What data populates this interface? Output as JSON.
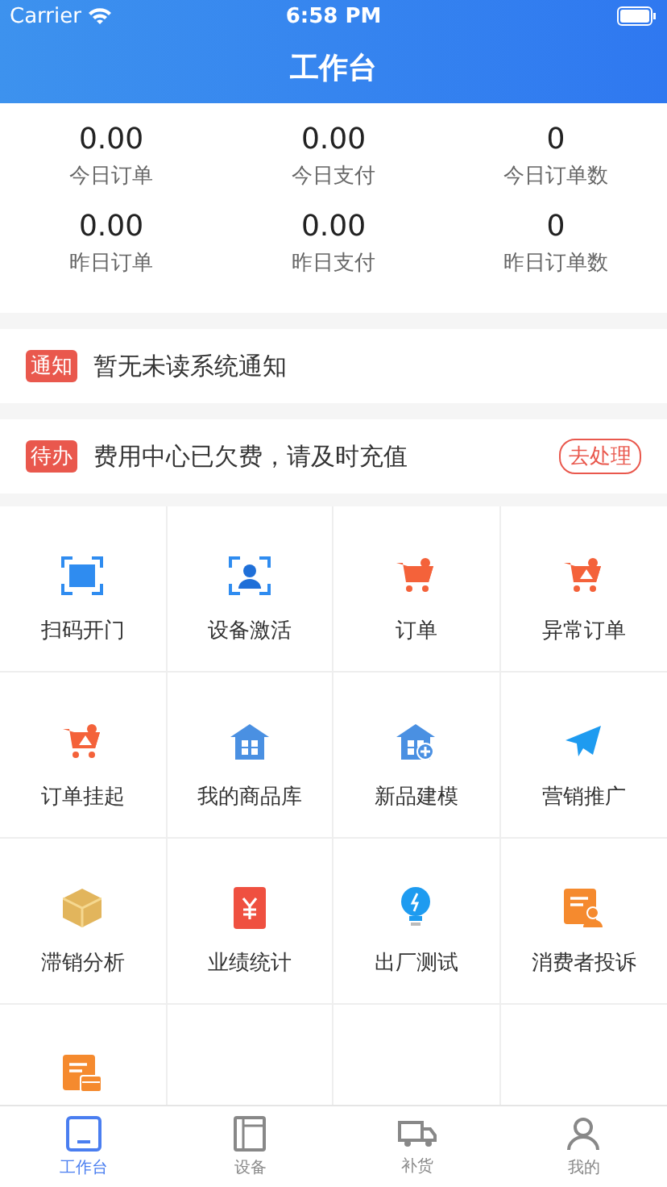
{
  "status_bar": {
    "carrier": "Carrier",
    "time": "6:58 PM"
  },
  "nav": {
    "title": "工作台"
  },
  "stats": [
    {
      "value": "0.00",
      "label": "今日订单"
    },
    {
      "value": "0.00",
      "label": "今日支付"
    },
    {
      "value": "0",
      "label": "今日订单数"
    },
    {
      "value": "0.00",
      "label": "昨日订单"
    },
    {
      "value": "0.00",
      "label": "昨日支付"
    },
    {
      "value": "0",
      "label": "昨日订单数"
    }
  ],
  "notices": [
    {
      "tag": "通知",
      "text": "暂无未读系统通知"
    },
    {
      "tag": "待办",
      "text": "费用中心已欠费，请及时充值",
      "action": "去处理"
    }
  ],
  "grid": [
    {
      "kind": "scan",
      "label": "扫码开门"
    },
    {
      "kind": "activate",
      "label": "设备激活"
    },
    {
      "kind": "cart",
      "label": "订单"
    },
    {
      "kind": "cart-alert",
      "label": "异常订单"
    },
    {
      "kind": "cart-alert",
      "label": "订单挂起"
    },
    {
      "kind": "store",
      "label": "我的商品库"
    },
    {
      "kind": "store-add",
      "label": "新品建模"
    },
    {
      "kind": "plane",
      "label": "营销推广"
    },
    {
      "kind": "box",
      "label": "滞销分析"
    },
    {
      "kind": "yen",
      "label": "业绩统计"
    },
    {
      "kind": "bulb",
      "label": "出厂测试"
    },
    {
      "kind": "complaint",
      "label": "消费者投诉"
    },
    {
      "kind": "card"
    }
  ],
  "tab_bar": [
    {
      "kind": "workbench",
      "label": "工作台",
      "selected": true
    },
    {
      "kind": "device",
      "label": "设备",
      "selected": false
    },
    {
      "kind": "restock",
      "label": "补货",
      "selected": false
    },
    {
      "kind": "mine",
      "label": "我的",
      "selected": false
    }
  ]
}
